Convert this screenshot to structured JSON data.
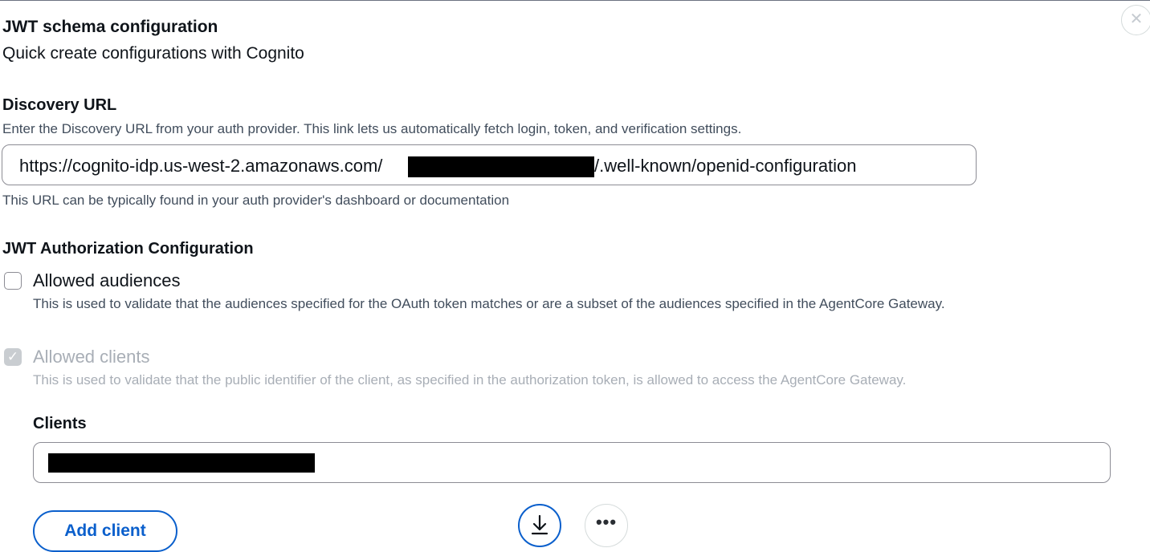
{
  "panel": {
    "title": "JWT schema configuration",
    "subtitle": "Quick create configurations with Cognito",
    "close_icon": "close-icon"
  },
  "discovery": {
    "label": "Discovery URL",
    "description": "Enter the Discovery URL from your auth provider. This link lets us automatically fetch login, token, and verification settings.",
    "value_prefix": "https://cognito-idp.us-west-2.amazonaws.com/",
    "value_suffix": "/.well-known/openid-configuration",
    "hint": "This URL can be typically found in your auth provider's dashboard or documentation"
  },
  "authorization": {
    "heading": "JWT Authorization Configuration",
    "audiences": {
      "label": "Allowed audiences",
      "description": "This is used to validate that the audiences specified for the OAuth token matches or are a subset of the audiences specified in the AgentCore Gateway.",
      "checked": false
    },
    "clients_option": {
      "label": "Allowed clients",
      "description": "This is used to validate that the public identifier of the client, as specified in the authorization token, is allowed to access the AgentCore Gateway.",
      "checked": true,
      "disabled": true
    }
  },
  "clients": {
    "label": "Clients",
    "add_button": "Add client"
  },
  "floating": {
    "download_icon": "download-icon",
    "more_icon": "more-icon",
    "more_glyph": "•••"
  },
  "colors": {
    "accent": "#0a5fcc",
    "text": "#0f141a",
    "muted": "#414d5c",
    "disabled": "#a8aeb6"
  }
}
